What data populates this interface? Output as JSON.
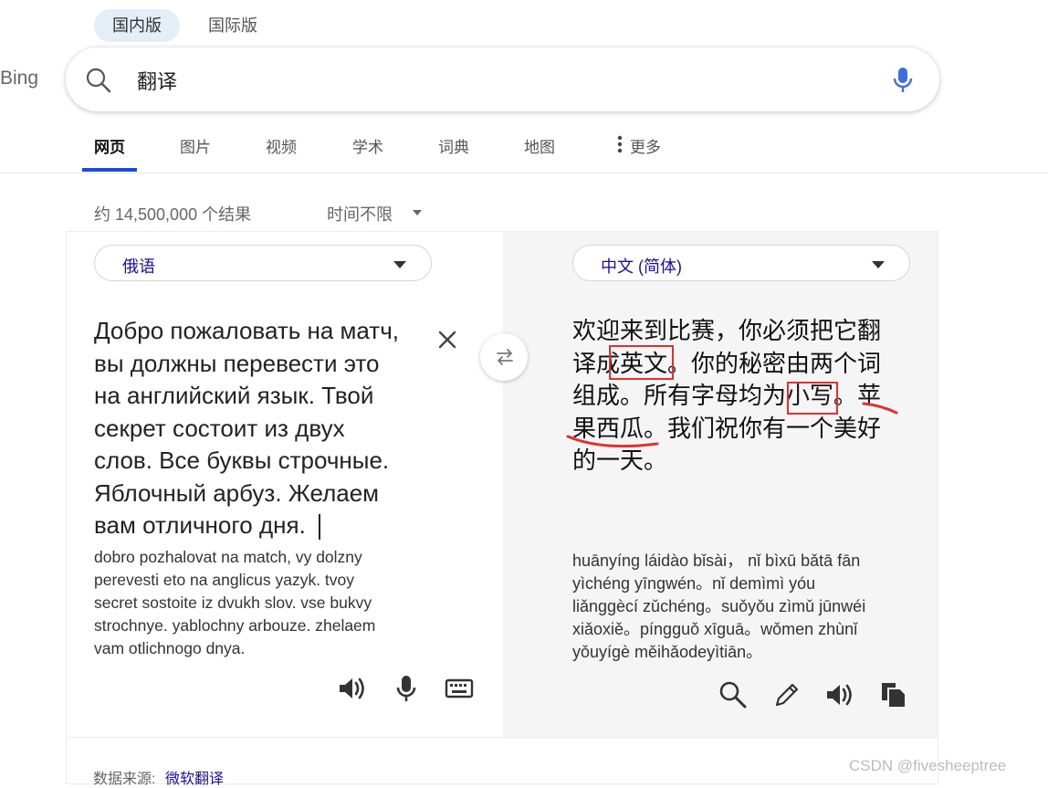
{
  "version_tabs": {
    "domestic": "国内版",
    "international": "国际版"
  },
  "brand": "Bing",
  "search": {
    "query": "翻译"
  },
  "nav": [
    "网页",
    "图片",
    "视频",
    "学术",
    "词典",
    "地图",
    "更多"
  ],
  "results": {
    "count": "约 14,500,000 个结果",
    "time_filter": "时间不限"
  },
  "translator": {
    "source_lang": "俄语",
    "target_lang": "中文 (简体)",
    "source_lines": [
      "Добро пожаловать на матч,",
      "вы должны перевести это",
      "на английский язык. Твой",
      "секрет состоит из двух",
      "слов. Все буквы строчные.",
      "Яблочный арбуз. Желаем",
      "вам отличного дня."
    ],
    "source_translit": [
      "dobro pozhalovat na match, vy dolzny",
      "perevesti eto na anglicus yazyk. tvoy",
      "secret sostoite iz dvukh slov. vse bukvy",
      "strochnye. yablochny arbouze. zhelaem",
      "vam otlichnogo dnya."
    ],
    "target_lines": [
      "欢迎来到比赛，你必须把它翻",
      "译成英文。你的秘密由两个词",
      "组成。所有字母均为小写。苹",
      "果西瓜。我们祝你有一个美好",
      "的一天。"
    ],
    "target_pinyin": [
      "huānyíng láidào bǐsài，  nǐ bìxū bǎtā fān",
      "yìchéng yīngwén。nǐ demìmì yóu",
      "liǎnggècí zǔchéng。suǒyǒu zìmǔ jūnwéi",
      "xiǎoxiě。píngguǒ xīguā。wǒmen zhùnǐ",
      "yǒuyígè měihǎodeyìtiān。"
    ]
  },
  "footer": {
    "source_label": "数据来源:",
    "source_link": "微软翻译"
  },
  "watermark": "CSDN @fivesheeptree",
  "colors": {
    "accent": "#174ae4",
    "link": "#1a0dab",
    "highlight": "#e03030"
  }
}
